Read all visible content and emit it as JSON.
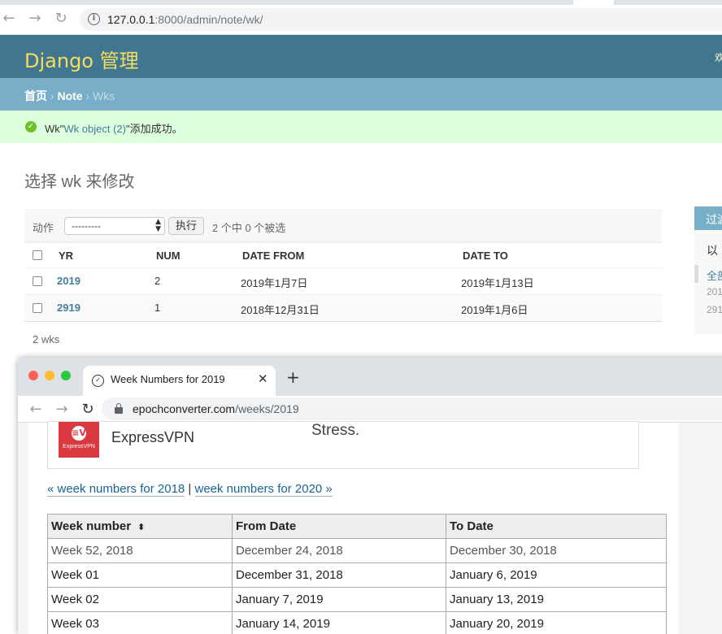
{
  "back_browser": {
    "url_host": "127.0.0.1",
    "url_rest": ":8000/admin/note/wk/"
  },
  "django": {
    "brand": "Django 管理",
    "user_text": "欢",
    "breadcrumb": {
      "home": "首页",
      "app": "Note",
      "current": "Wks",
      "separator": "›"
    },
    "message": {
      "prefix": "Wk\"",
      "link": "Wk object (2)",
      "suffix": "\"添加成功。"
    },
    "title": "选择 wk 来修改",
    "actions": {
      "label": "动作",
      "select_value": "---------",
      "go": "执行",
      "counter": "2 个中 0 个被选"
    },
    "table": {
      "headers": [
        "YR",
        "NUM",
        "DATE FROM",
        "DATE TO"
      ],
      "rows": [
        {
          "yr": "2019",
          "num": "2",
          "date_from": "2019年1月7日",
          "date_to": "2019年1月13日"
        },
        {
          "yr": "2919",
          "num": "1",
          "date_from": "2018年12月31日",
          "date_to": "2019年1月6日"
        }
      ]
    },
    "count": "2 wks",
    "filter": {
      "title": "过滤",
      "subtitle": "以",
      "all": "全部",
      "opt1": "201",
      "opt2": "291"
    }
  },
  "front_browser": {
    "tab_title": "Week Numbers for 2019",
    "url_host": "epochconverter.com",
    "url_rest": "/weeks/2019",
    "ad": {
      "logo_text": "ExpressVPN",
      "logo_mark": "≡V",
      "name": "ExpressVPN",
      "tagline": "Stress."
    },
    "nav": {
      "prev": "« week numbers for 2018",
      "sep": " | ",
      "next": "week numbers for 2020 »"
    },
    "table": {
      "headers": [
        "Week number",
        "From Date",
        "To Date"
      ],
      "sort_icon": "⬍",
      "rows": [
        [
          "Week 52, 2018",
          "December 24, 2018",
          "December 30, 2018"
        ],
        [
          "Week 01",
          "December 31, 2018",
          "January 6, 2019"
        ],
        [
          "Week 02",
          "January 7, 2019",
          "January 13, 2019"
        ],
        [
          "Week 03",
          "January 14, 2019",
          "January 20, 2019"
        ]
      ]
    }
  },
  "colors": {
    "django_header": "#417690",
    "django_brand": "#f5dd5d",
    "breadcrumb_bg": "#79aec8",
    "success_bg": "#ddffdd",
    "link": "#447e9b"
  }
}
